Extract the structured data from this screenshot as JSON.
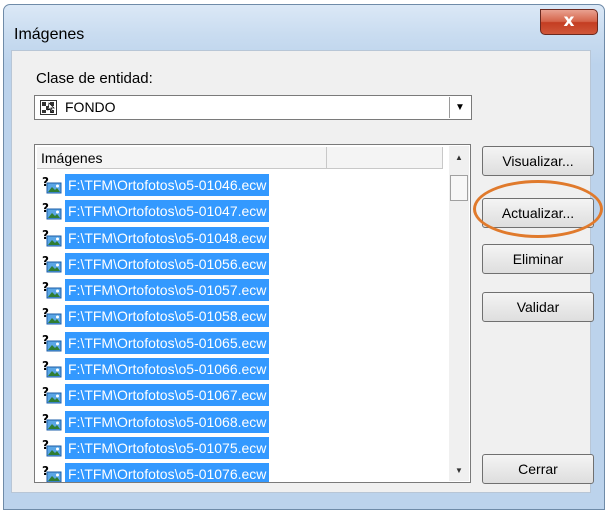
{
  "window": {
    "title": "Imágenes",
    "close_label": "x"
  },
  "entity_class": {
    "label": "Clase de entidad:",
    "selected": "FONDO"
  },
  "list": {
    "column_header": "Imágenes",
    "items": [
      "F:\\TFM\\Ortofotos\\o5-01046.ecw",
      "F:\\TFM\\Ortofotos\\o5-01047.ecw",
      "F:\\TFM\\Ortofotos\\o5-01048.ecw",
      "F:\\TFM\\Ortofotos\\o5-01056.ecw",
      "F:\\TFM\\Ortofotos\\o5-01057.ecw",
      "F:\\TFM\\Ortofotos\\o5-01058.ecw",
      "F:\\TFM\\Ortofotos\\o5-01065.ecw",
      "F:\\TFM\\Ortofotos\\o5-01066.ecw",
      "F:\\TFM\\Ortofotos\\o5-01067.ecw",
      "F:\\TFM\\Ortofotos\\o5-01068.ecw",
      "F:\\TFM\\Ortofotos\\o5-01075.ecw",
      "F:\\TFM\\Ortofotos\\o5-01076.ecw"
    ]
  },
  "buttons": {
    "visualizar": "Visualizar...",
    "actualizar": "Actualizar...",
    "eliminar": "Eliminar",
    "validar": "Validar",
    "cerrar": "Cerrar"
  },
  "colors": {
    "selection": "#3399ff",
    "annotation_ring": "#e07a2c"
  }
}
